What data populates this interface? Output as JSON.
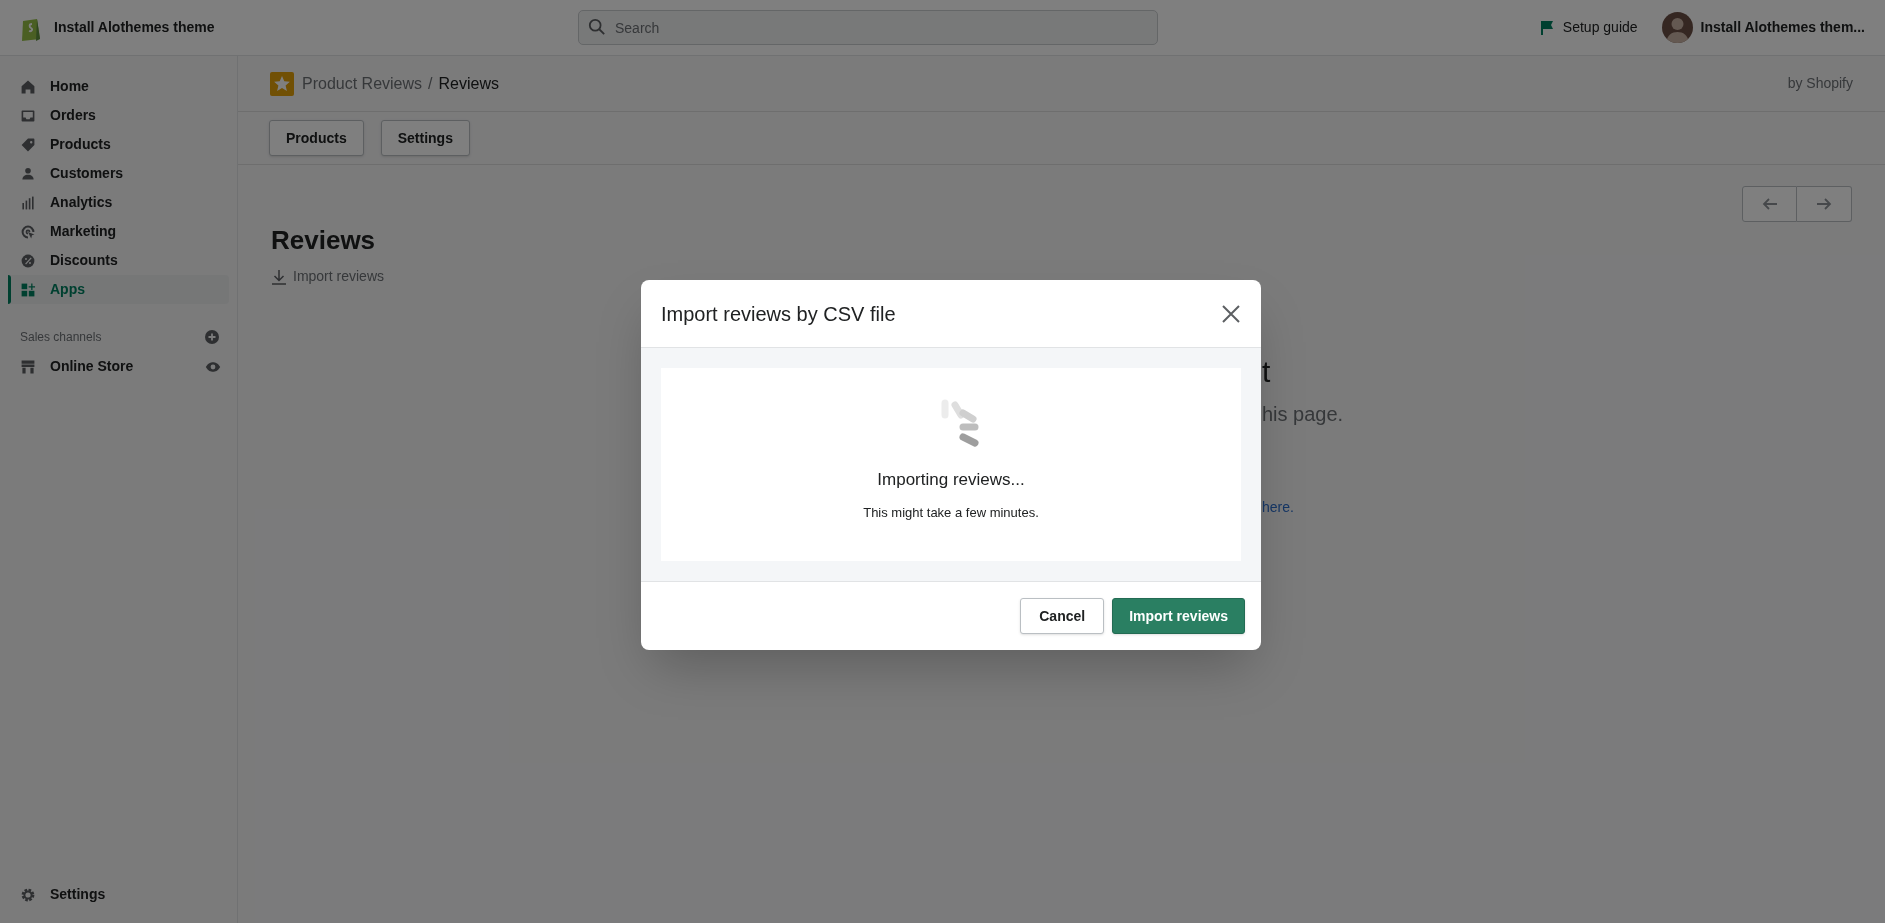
{
  "top_bar": {
    "store_name": "Install Alothemes theme",
    "search": {
      "placeholder": "Search"
    },
    "setup_guide": "Setup guide",
    "account_name": "Install Alothemes them..."
  },
  "sidebar": {
    "items": [
      {
        "label": "Home",
        "selected": false
      },
      {
        "label": "Orders",
        "selected": false
      },
      {
        "label": "Products",
        "selected": false
      },
      {
        "label": "Customers",
        "selected": false
      },
      {
        "label": "Analytics",
        "selected": false
      },
      {
        "label": "Marketing",
        "selected": false
      },
      {
        "label": "Discounts",
        "selected": false
      },
      {
        "label": "Apps",
        "selected": true
      }
    ],
    "sales_channels": {
      "title": "Sales channels",
      "items": [
        {
          "label": "Online Store"
        }
      ]
    },
    "settings": "Settings"
  },
  "app_header": {
    "app_name": "Product Reviews",
    "separator": "/",
    "page": "Reviews",
    "publisher": "by Shopify"
  },
  "app_tabs": [
    "Products",
    "Settings"
  ],
  "page": {
    "title": "Reviews",
    "action": "Import reviews"
  },
  "background_fragments": [
    {
      "kind": "heading",
      "text": "t"
    },
    {
      "kind": "text",
      "text": "his page."
    },
    {
      "kind": "link",
      "text": "here."
    }
  ],
  "modal": {
    "title": "Import reviews by CSV file",
    "status_title": "Importing reviews...",
    "status_text": "This might take a few minutes.",
    "buttons": [
      {
        "label": "Cancel",
        "kind": "secondary"
      },
      {
        "label": "Import reviews",
        "kind": "primary"
      }
    ]
  }
}
